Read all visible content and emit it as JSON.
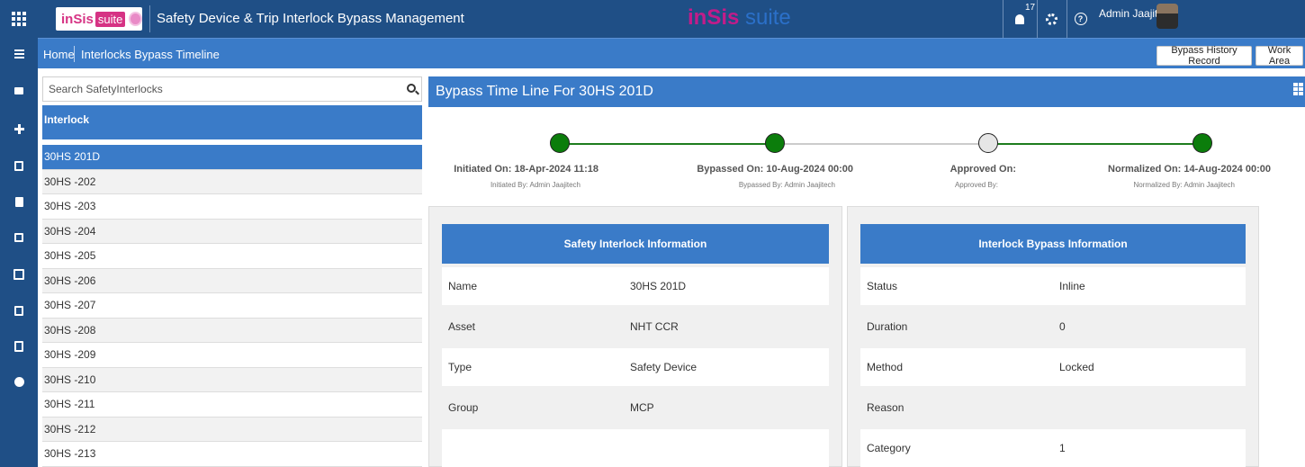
{
  "header": {
    "logo_ins": "inSis",
    "logo_suite": "suite",
    "app_title": "Safety Device & Trip Interlock Bypass Management",
    "center_logo_ins": "inSis",
    "center_logo_suite": " suite",
    "notification_count": "17",
    "user_name": "Admin Jaajitech"
  },
  "breadcrumb": {
    "home": "Home",
    "page": "Interlocks Bypass Timeline"
  },
  "toolbar": {
    "history_label": "Bypass History Record",
    "work_area_label": "Work Area"
  },
  "sidebar": {
    "search_placeholder": "Search SafetyInterlocks",
    "list_header": "Interlock",
    "items": [
      {
        "label": "30HS 201D",
        "active": true
      },
      {
        "label": "30HS -202"
      },
      {
        "label": "30HS -203"
      },
      {
        "label": "30HS -204"
      },
      {
        "label": "30HS -205"
      },
      {
        "label": "30HS -206"
      },
      {
        "label": "30HS -207"
      },
      {
        "label": "30HS -208"
      },
      {
        "label": "30HS -209"
      },
      {
        "label": "30HS -210"
      },
      {
        "label": "30HS -211"
      },
      {
        "label": "30HS -212"
      },
      {
        "label": "30HS -213"
      }
    ]
  },
  "main": {
    "title": "Bypass Time Line For 30HS 201D",
    "timeline": [
      {
        "label": "Initiated On: 18-Apr-2024 11:18",
        "sub": "Initiated By: Admin Jaajitech",
        "status": "done"
      },
      {
        "label": "Bypassed On: 10-Aug-2024 00:00",
        "sub": "Bypassed By: Admin Jaajitech",
        "status": "done"
      },
      {
        "label": "Approved On:",
        "sub": "Approved By:",
        "status": "pending"
      },
      {
        "label": "Normalized On: 14-Aug-2024 00:00",
        "sub": "Normalized By: Admin Jaajitech",
        "status": "done"
      }
    ],
    "interlock_info": {
      "title": "Safety Interlock Information",
      "rows": [
        {
          "key": "Name",
          "value": "30HS 201D"
        },
        {
          "key": "Asset",
          "value": "NHT CCR"
        },
        {
          "key": "Type",
          "value": "Safety Device"
        },
        {
          "key": "Group",
          "value": "MCP"
        },
        {
          "key": "",
          "value": ""
        }
      ]
    },
    "bypass_info": {
      "title": "Interlock Bypass Information",
      "rows": [
        {
          "key": "Status",
          "value": "Inline"
        },
        {
          "key": "Duration",
          "value": "0"
        },
        {
          "key": "Method",
          "value": "Locked"
        },
        {
          "key": "Reason",
          "value": ""
        },
        {
          "key": "Category",
          "value": "1"
        }
      ]
    }
  },
  "colors": {
    "navy": "#1f4f86",
    "accent_blue": "#3a7bc8",
    "done_green": "#0b7d0b",
    "pending_gray": "#e6e6e6"
  },
  "icons": [
    "apps-icon",
    "menu-icon",
    "chat-icon",
    "plus-icon",
    "dashboard-icon",
    "document-icon",
    "report-icon",
    "calculator-icon",
    "hourglass-icon",
    "clipboard-icon",
    "globe-icon",
    "bell-icon",
    "gear-icon",
    "help-icon",
    "search-icon",
    "grid-view-icon"
  ]
}
